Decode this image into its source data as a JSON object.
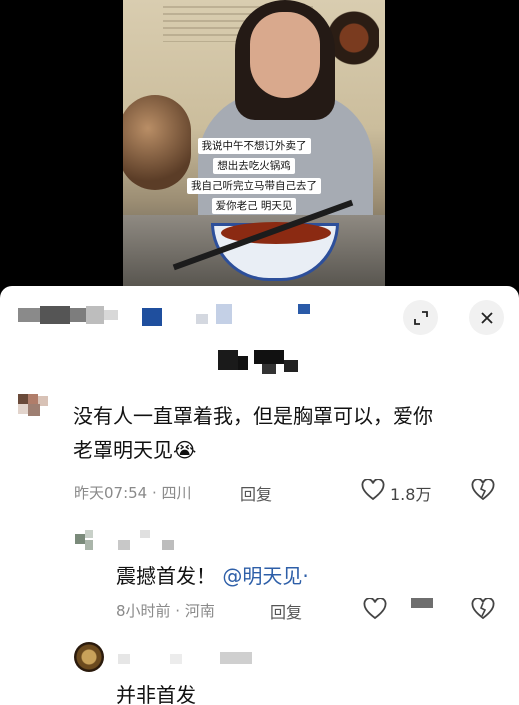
{
  "video": {
    "captions": [
      "我说中午不想订外卖了",
      "想出去吃火锅鸡",
      "我自己听完立马带自己去了",
      "爱你老己 明天见"
    ]
  },
  "sheet": {
    "icons": {
      "expand": "expand-icon",
      "close": "close-icon"
    }
  },
  "comments": [
    {
      "text_line1": "没有人一直罩着我，但是胸罩可以，爱你",
      "text_line2": "老罩明天见",
      "emoji": "😭",
      "time_location": "昨天07:54 · 四川",
      "reply_label": "回复",
      "like_count": "1.8万"
    }
  ],
  "replies": [
    {
      "text": "震撼首发！",
      "mention": "@明天见·",
      "time_location": "8小时前 · 河南",
      "reply_label": "回复"
    },
    {
      "text": "并非首发"
    }
  ],
  "colors": {
    "mention": "#2e5fa8",
    "meta": "#8a8a8a",
    "sheet_bg": "#ffffff"
  }
}
